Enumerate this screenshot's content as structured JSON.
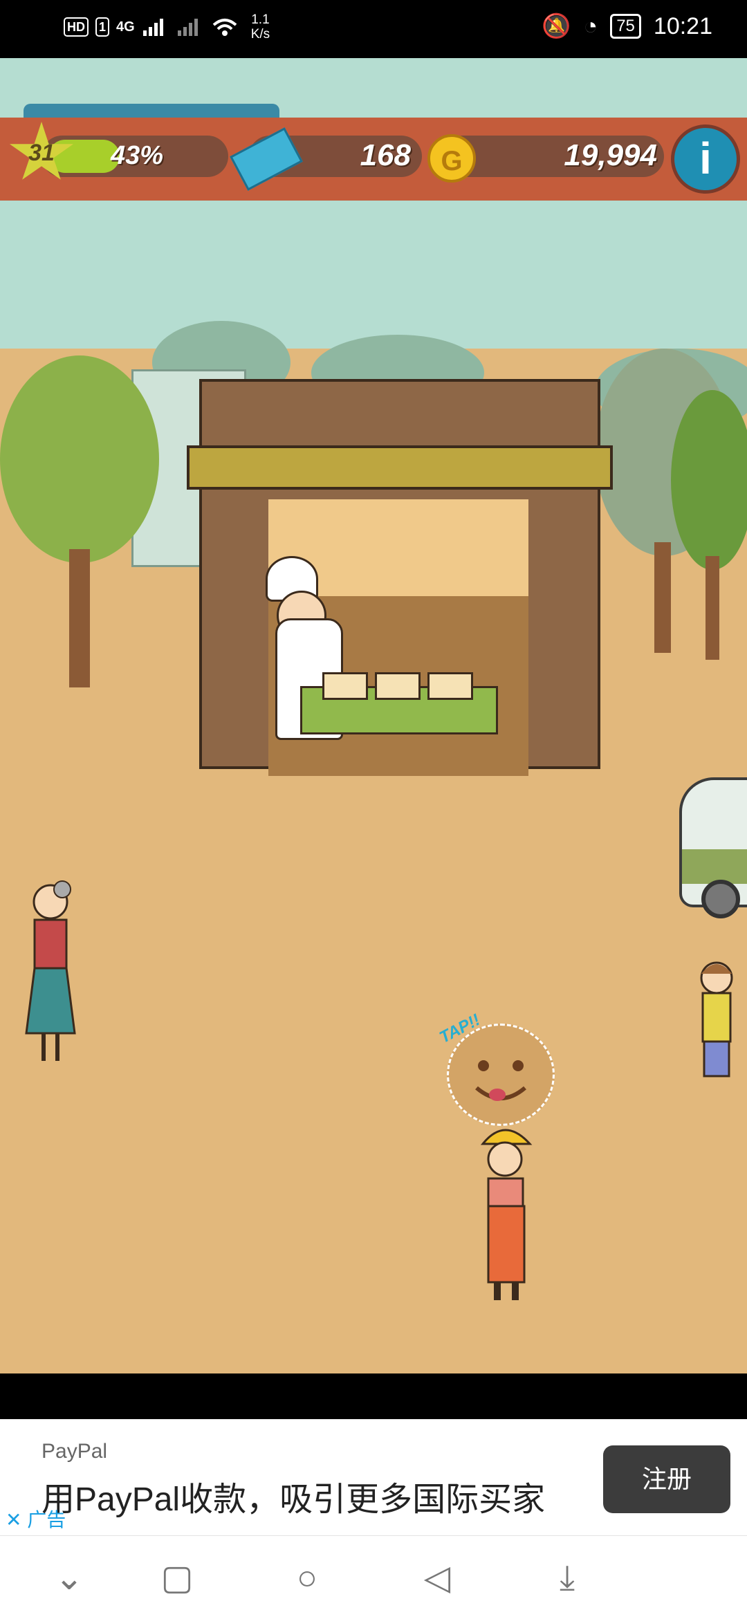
{
  "status_bar": {
    "hd": "HD",
    "sim1": "1",
    "network": "4G",
    "speed": "1.1",
    "speed_unit": "K/s",
    "battery": "75",
    "time": "10:21"
  },
  "hud": {
    "level": "31",
    "xp_percent": "43%",
    "xp_progress": 0.43,
    "tickets": "168",
    "coin_icon_letter": "G",
    "coins": "19,994",
    "info_icon_letter": "i"
  },
  "scene": {
    "tap_label": "TAP!!"
  },
  "ad": {
    "brand": "PayPal",
    "text": "用PayPal收款，吸引更多国际买家",
    "button": "注册",
    "ad_label": "广告"
  },
  "colors": {
    "sky": "#b5ddd1",
    "ground": "#e2b87c",
    "hud_bar": "#c45c3b",
    "xp_green": "#a8cf2a",
    "info_blue": "#1f8fb3"
  }
}
